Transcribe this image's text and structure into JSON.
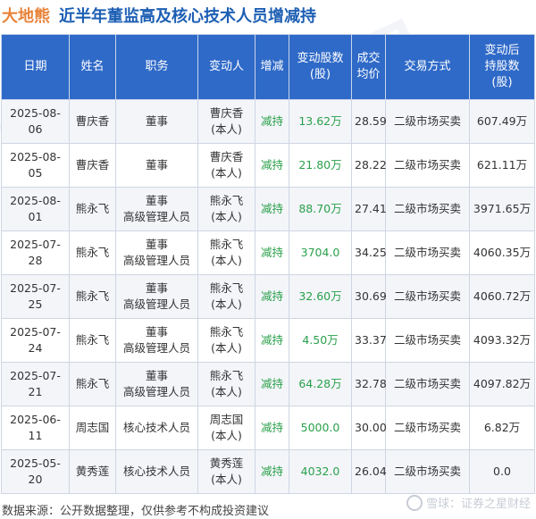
{
  "header": {
    "company": "大地熊",
    "title": "近半年董监高及核心技术人员增减持"
  },
  "table": {
    "columns": [
      "日期",
      "姓名",
      "职务",
      "变动人",
      "增减",
      "变动股数\n(股)",
      "成交\n均价",
      "交易方式",
      "变动后\n持股数\n(股)"
    ],
    "rows": [
      {
        "date": "2025-08-06",
        "name": "曹庆香",
        "role": [
          "董事"
        ],
        "actor": [
          "曹庆香",
          "(本人)"
        ],
        "change": "减持",
        "shares": "13.62万",
        "price": "28.59",
        "method": "二级市场买卖",
        "holding": "607.49万"
      },
      {
        "date": "2025-08-05",
        "name": "曹庆香",
        "role": [
          "董事"
        ],
        "actor": [
          "曹庆香",
          "(本人)"
        ],
        "change": "减持",
        "shares": "21.80万",
        "price": "28.22",
        "method": "二级市场买卖",
        "holding": "621.11万"
      },
      {
        "date": "2025-08-01",
        "name": "熊永飞",
        "role": [
          "董事",
          "高级管理人员"
        ],
        "actor": [
          "熊永飞",
          "(本人)"
        ],
        "change": "减持",
        "shares": "88.70万",
        "price": "27.41",
        "method": "二级市场买卖",
        "holding": "3971.65万"
      },
      {
        "date": "2025-07-28",
        "name": "熊永飞",
        "role": [
          "董事",
          "高级管理人员"
        ],
        "actor": [
          "熊永飞",
          "(本人)"
        ],
        "change": "减持",
        "shares": "3704.0",
        "price": "34.25",
        "method": "二级市场买卖",
        "holding": "4060.35万"
      },
      {
        "date": "2025-07-25",
        "name": "熊永飞",
        "role": [
          "董事",
          "高级管理人员"
        ],
        "actor": [
          "熊永飞",
          "(本人)"
        ],
        "change": "减持",
        "shares": "32.60万",
        "price": "30.69",
        "method": "二级市场买卖",
        "holding": "4060.72万"
      },
      {
        "date": "2025-07-24",
        "name": "熊永飞",
        "role": [
          "董事",
          "高级管理人员"
        ],
        "actor": [
          "熊永飞",
          "(本人)"
        ],
        "change": "减持",
        "shares": "4.50万",
        "price": "33.37",
        "method": "二级市场买卖",
        "holding": "4093.32万"
      },
      {
        "date": "2025-07-21",
        "name": "熊永飞",
        "role": [
          "董事",
          "高级管理人员"
        ],
        "actor": [
          "熊永飞",
          "(本人)"
        ],
        "change": "减持",
        "shares": "64.28万",
        "price": "32.78",
        "method": "二级市场买卖",
        "holding": "4097.82万"
      },
      {
        "date": "2025-06-11",
        "name": "周志国",
        "role": [
          "核心技术人员"
        ],
        "actor": [
          "周志国",
          "(本人)"
        ],
        "change": "减持",
        "shares": "5000.0",
        "price": "30.00",
        "method": "二级市场买卖",
        "holding": "6.82万"
      },
      {
        "date": "2025-05-20",
        "name": "黄秀莲",
        "role": [
          "核心技术人员"
        ],
        "actor": [
          "黄秀莲",
          "(本人)"
        ],
        "change": "减持",
        "shares": "4032.0",
        "price": "26.04",
        "method": "二级市场买卖",
        "holding": "0.0"
      }
    ]
  },
  "footer": {
    "source": "数据来源：公开数据整理，仅供参考不构成投资建议",
    "watermark_text": "雪球：证券之星财经"
  },
  "background_watermark": [
    "证",
    "券",
    "之",
    "星"
  ],
  "colors": {
    "company": "#e8833a",
    "title": "#1d5fb4",
    "header_bg": "#2f6ac8",
    "change_green": "#2aa04a"
  }
}
